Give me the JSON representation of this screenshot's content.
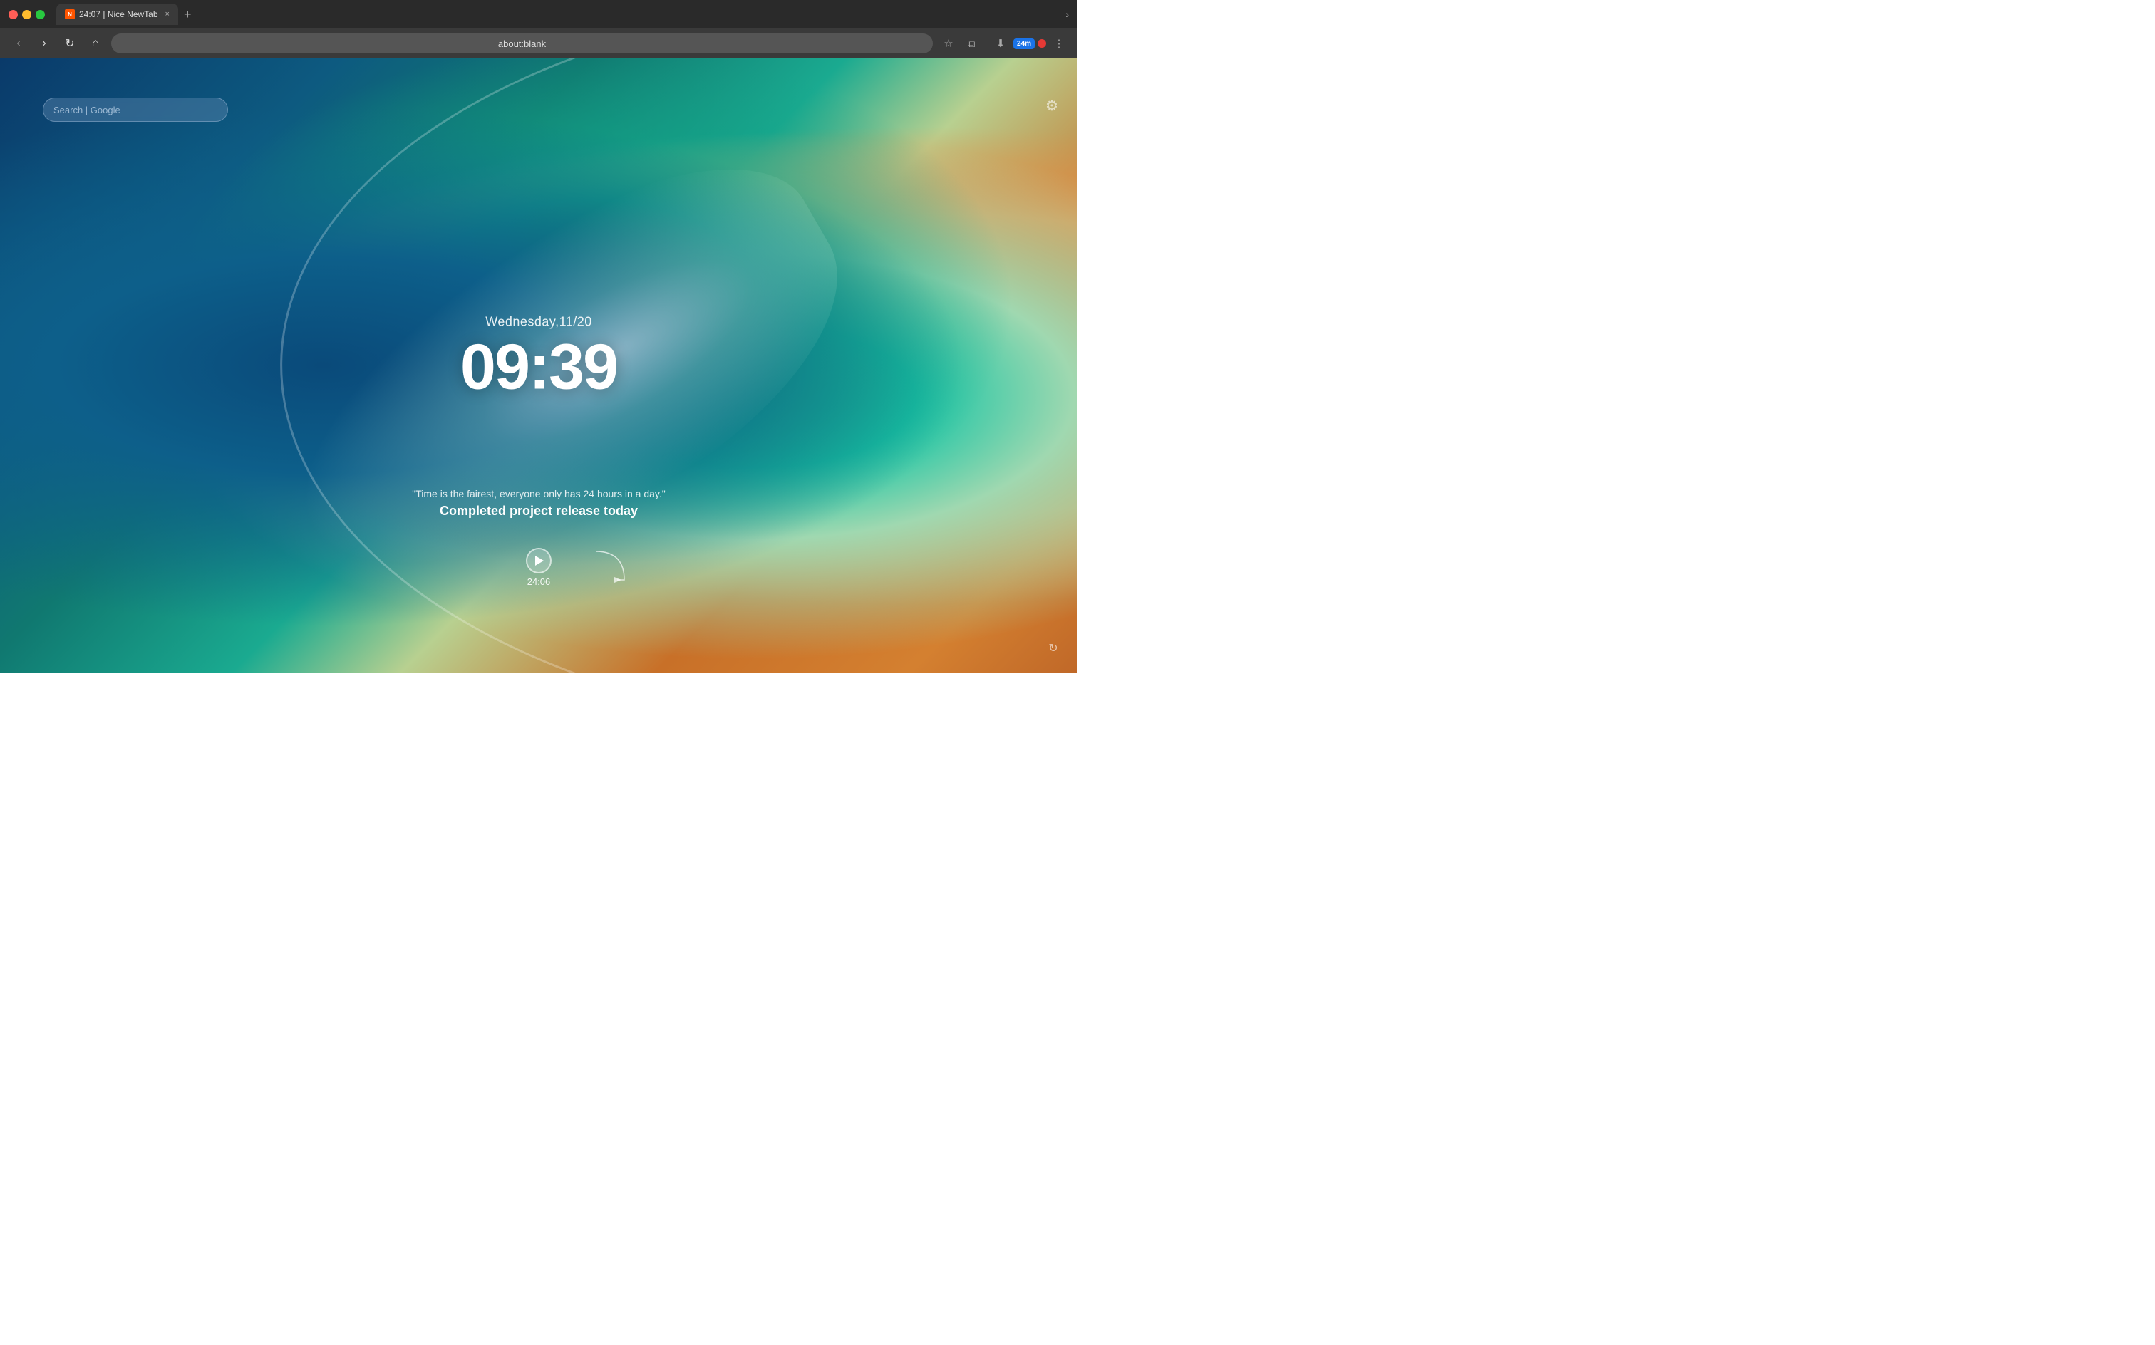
{
  "browser": {
    "tab": {
      "favicon_text": "N",
      "title": "24:07 | Nice NewTab",
      "close_label": "×"
    },
    "new_tab_label": "+",
    "chevron_label": "›",
    "toolbar": {
      "back_label": "‹",
      "forward_label": "›",
      "reload_label": "↻",
      "home_label": "⌂",
      "address": "about:blank",
      "bookmark_label": "☆",
      "extensions_label": "⧉",
      "download_label": "⬇",
      "timer_badge": "24m",
      "record_label": "",
      "menu_label": "⋮"
    }
  },
  "page": {
    "search_placeholder": "Search | Google",
    "date": "Wednesday,11/20",
    "time": "09:39",
    "quote": "\"Time is the fairest, everyone only has 24 hours in a day.\"",
    "task": "Completed project release today",
    "timer_display": "24:06",
    "settings_label": "⚙",
    "refresh_label": "↻"
  }
}
